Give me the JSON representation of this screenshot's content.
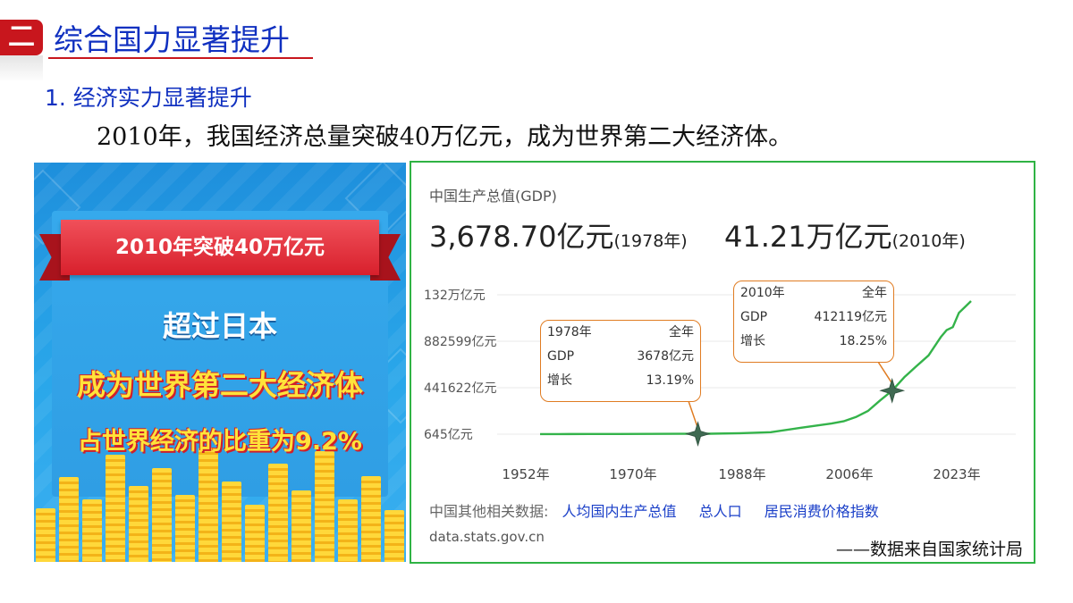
{
  "header": {
    "section_number": "二",
    "section_title": "综合国力显著提升",
    "subsection_title": "1. 经济实力显著提升",
    "lead_text": "2010年，我国经济总量突破40万亿元，成为世界第二大经济体。"
  },
  "poster": {
    "ribbon_text": "2010年突破40万亿元",
    "line1": "超过日本",
    "line2": "成为世界第二大经济体",
    "line3": "占世界经济的比重为9.2%",
    "colors": {
      "background": "#2aa7ea",
      "ribbon": "#d8202c",
      "highlight": "#ffe33a",
      "coins": "#f3b318"
    }
  },
  "gdp_card": {
    "label": "中国生产总值(GDP)",
    "stat_1978_value": "3,678.70亿元",
    "stat_1978_year": "(1978年)",
    "stat_2010_value": "41.21万亿元",
    "stat_2010_year": "(2010年)",
    "tooltips": {
      "t1978": {
        "year": "1978年",
        "period": "全年",
        "gdp_label": "GDP",
        "gdp_value": "3678亿元",
        "growth_label": "增长",
        "growth_value": "13.19%"
      },
      "t2010": {
        "year": "2010年",
        "period": "全年",
        "gdp_label": "GDP",
        "gdp_value": "412119亿元",
        "growth_label": "增长",
        "growth_value": "18.25%"
      }
    },
    "related_label": "中国其他相关数据:",
    "related_links": [
      "人均国内生产总值",
      "总人口",
      "居民消费价格指数"
    ],
    "source": "data.stats.gov.cn",
    "credit": "——数据来自国家统计局",
    "colors": {
      "line": "#34b34a",
      "grid": "#e8e8e8",
      "tooltip_border": "#e07c22",
      "link": "#1a3fc8",
      "frame": "#2fb344"
    }
  },
  "chart_data": {
    "type": "line",
    "title": "中国生产总值(GDP)",
    "xlabel": "",
    "ylabel": "",
    "x_ticks": [
      "1952年",
      "1970年",
      "1988年",
      "2006年",
      "2023年"
    ],
    "y_ticks": [
      "645亿元",
      "441622亿元",
      "882599亿元",
      "132万亿元"
    ],
    "ylim": [
      645,
      1320000
    ],
    "grid": true,
    "series": [
      {
        "name": "",
        "x": [
          1952,
          1955,
          1960,
          1965,
          1970,
          1975,
          1978,
          1980,
          1985,
          1990,
          1995,
          2000,
          2002,
          2004,
          2006,
          2008,
          2010,
          2012,
          2014,
          2016,
          2018,
          2019,
          2020,
          2021,
          2022,
          2023
        ],
        "values": [
          679,
          910,
          1470,
          1734,
          2279,
          3040,
          3679,
          4588,
          9099,
          18873,
          61340,
          100280,
          121717,
          161840,
          219438,
          319245,
          412119,
          538580,
          643563,
          746395,
          919281,
          986515,
          1013567,
          1149237,
          1204724,
          1260582
        ]
      }
    ],
    "highlight_points": [
      {
        "x": 1978,
        "y": 3679
      },
      {
        "x": 2010,
        "y": 412119
      }
    ]
  }
}
